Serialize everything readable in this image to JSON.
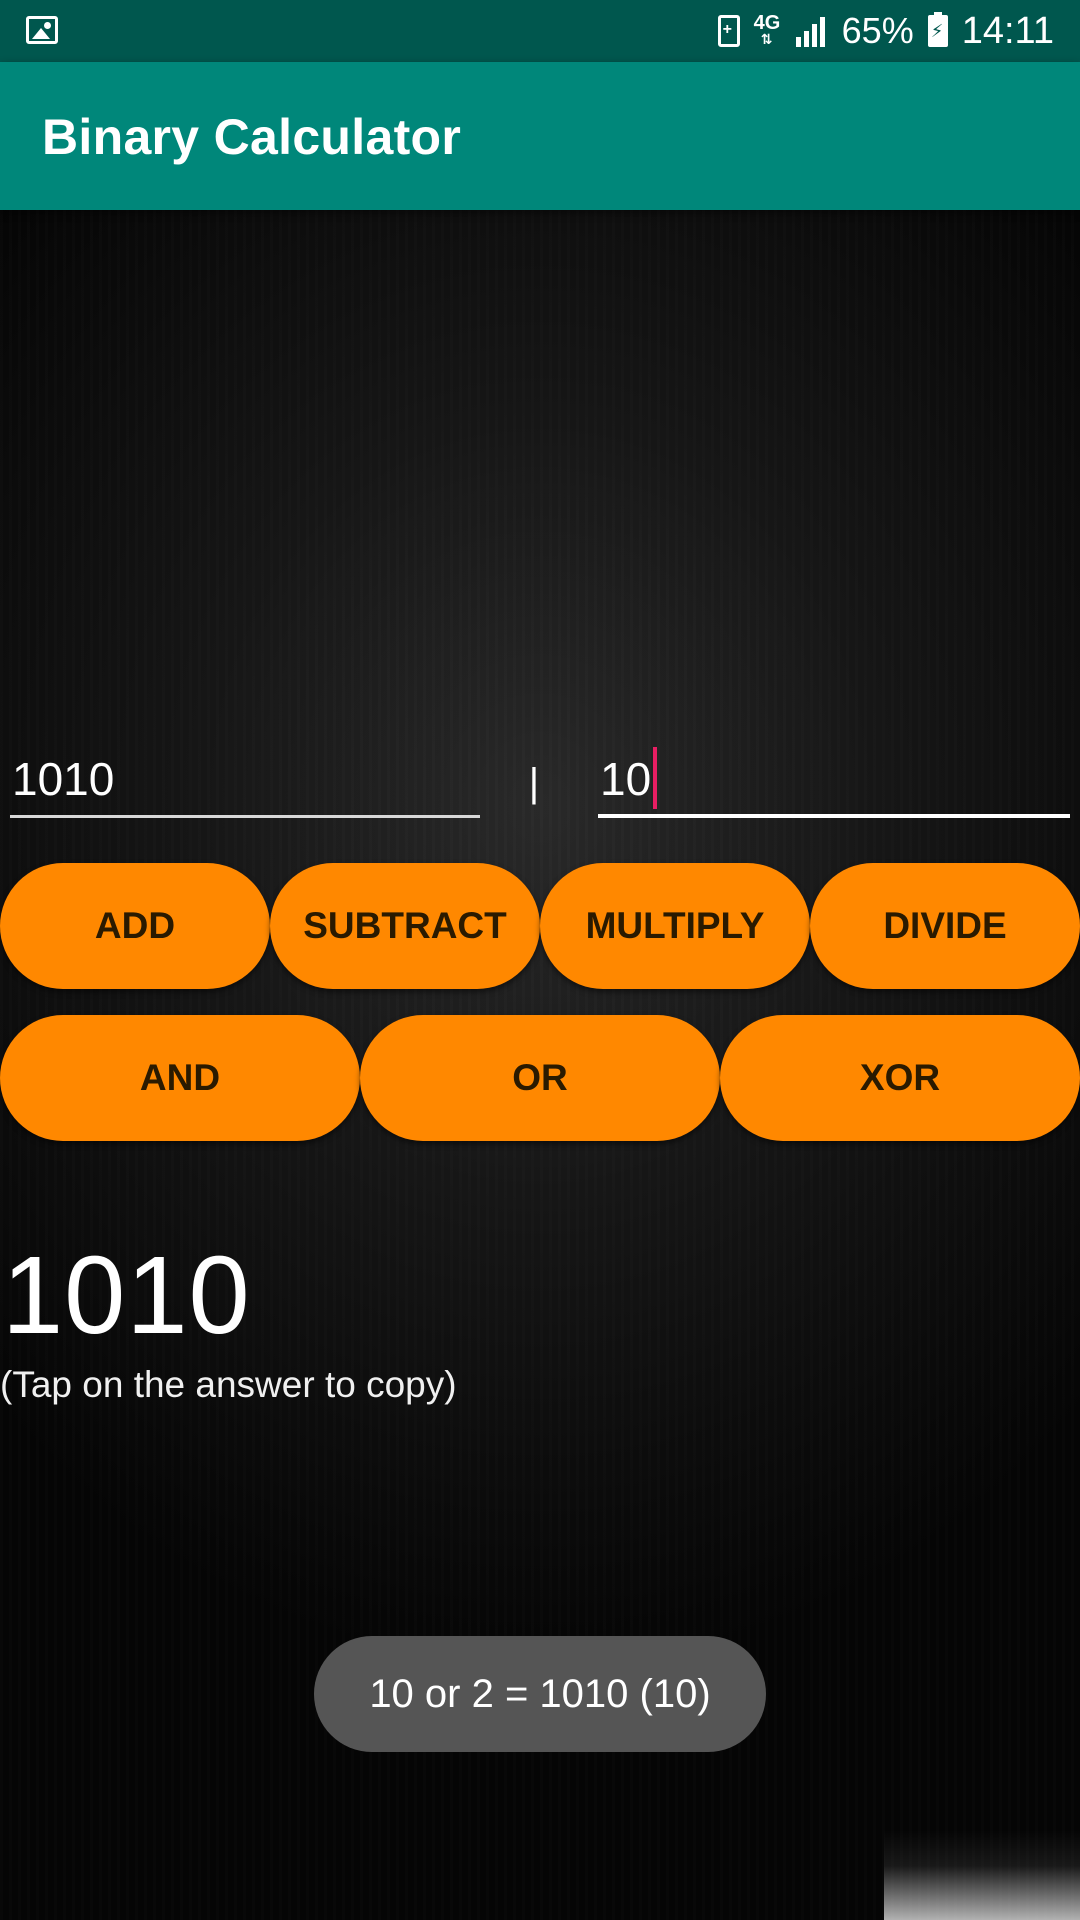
{
  "status_bar": {
    "left_icon": "gallery-icon",
    "icons": [
      "battery-saver-icon",
      "network-4g-icon",
      "signal-icon",
      "battery-charging-icon"
    ],
    "network_label": "4G",
    "battery_percent": "65%",
    "time": "14:11"
  },
  "app_bar": {
    "title": "Binary Calculator"
  },
  "inputs": {
    "first_value": "1010",
    "operator_symbol": "|",
    "second_value": "10"
  },
  "buttons": {
    "add": "ADD",
    "subtract": "SUBTRACT",
    "multiply": "MULTIPLY",
    "divide": "DIVIDE",
    "and": "AND",
    "or": "OR",
    "xor": "XOR"
  },
  "result": {
    "value": "1010",
    "hint": "(Tap on the answer to copy)"
  },
  "toast": {
    "message": "10 or 2 = 1010 (10)"
  },
  "colors": {
    "status_bar": "#00574e",
    "app_bar": "#00877a",
    "button": "#ff8800",
    "caret": "#e91e63",
    "toast": "#555555"
  }
}
